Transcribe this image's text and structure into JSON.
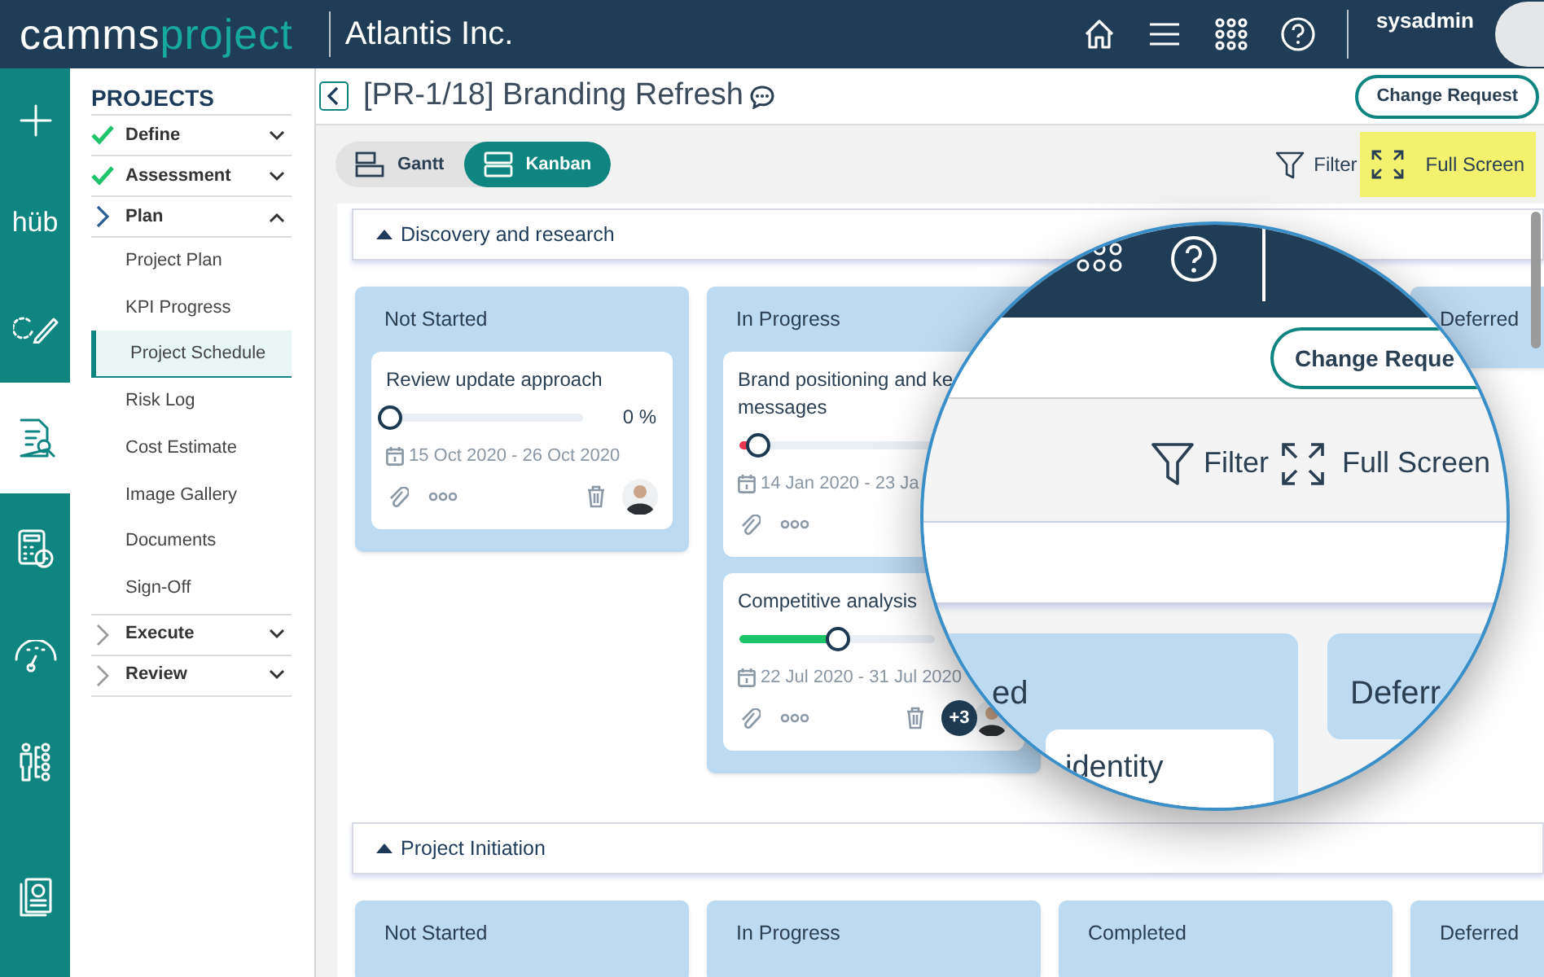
{
  "header": {
    "logo": [
      {
        "text": "camms",
        "kind": "plain"
      },
      {
        "text": "project",
        "kind": "accent"
      }
    ],
    "company": "Atlantis Inc.",
    "user": "sysadmin"
  },
  "rail": [
    {
      "kind": "plus",
      "selected": false
    },
    {
      "kind": "hub",
      "label": "hüb",
      "selected": false
    },
    {
      "kind": "edit",
      "selected": false
    },
    {
      "kind": "document-search",
      "selected": true
    },
    {
      "kind": "calculator",
      "selected": false
    },
    {
      "kind": "gauge",
      "selected": false
    },
    {
      "kind": "people",
      "selected": false
    },
    {
      "kind": "report",
      "selected": false
    }
  ],
  "sidebar": {
    "heading": "PROJECTS",
    "stages": [
      {
        "label": "Define",
        "kind": "done",
        "expanded": false
      },
      {
        "label": "Assessment",
        "kind": "done",
        "expanded": false
      },
      {
        "label": "Plan",
        "kind": "current",
        "expanded": true,
        "items": [
          {
            "label": "Project Plan",
            "selected": false
          },
          {
            "label": "KPI Progress",
            "selected": false
          },
          {
            "label": "Project Schedule",
            "selected": true
          },
          {
            "label": "Risk Log",
            "selected": false
          },
          {
            "label": "Cost Estimate",
            "selected": false
          },
          {
            "label": "Image Gallery",
            "selected": false
          },
          {
            "label": "Documents",
            "selected": false
          },
          {
            "label": "Sign-Off",
            "selected": false
          }
        ]
      },
      {
        "label": "Execute",
        "kind": "pending",
        "expanded": false
      },
      {
        "label": "Review",
        "kind": "pending",
        "expanded": false
      }
    ]
  },
  "page": {
    "title": "[PR-1/18] Branding Refresh",
    "action": "Change Request"
  },
  "views": [
    {
      "label": "Gantt",
      "kind": "gantt",
      "selected": false
    },
    {
      "label": "Kanban",
      "kind": "kanban",
      "selected": true
    }
  ],
  "toolbar": [
    {
      "label": "Filter",
      "kind": "filter",
      "highlighted": false
    },
    {
      "label": "Full Screen",
      "kind": "fullscreen",
      "highlighted": true
    }
  ],
  "sections": [
    {
      "title": "Discovery and research",
      "expanded": true,
      "columns": [
        {
          "kind": "status",
          "title": "Not Started",
          "cards": [
            {
              "title": "Review update approach",
              "level": 0,
              "reading": "0 %",
              "dates": "15 Oct 2020 - 26 Oct 2020",
              "deletable": true,
              "assigned": true
            }
          ]
        },
        {
          "kind": "status",
          "title": "In Progress",
          "cards": [
            {
              "title": "Brand positioning and ke\nmessages",
              "level": 0.08,
              "color": "#e8374f",
              "dates": "14 Jan 2020 - 23 Ja"
            },
            {
              "title": "Competitive analysis",
              "level": 0.49,
              "color": "#1ec46a",
              "dates": "22 Jul 2020 - 31 Jul 2020",
              "more": "+3",
              "deletable": true,
              "assigned": true
            }
          ]
        },
        {
          "kind": "covered"
        },
        {
          "kind": "status",
          "title": "Deferred"
        }
      ]
    },
    {
      "title": "Project Initiation",
      "expanded": true,
      "columns": [
        {
          "kind": "status",
          "title": "Not Started"
        },
        {
          "kind": "status",
          "title": "In Progress"
        },
        {
          "kind": "status",
          "title": "Completed"
        },
        {
          "kind": "status",
          "title": "Deferred"
        }
      ]
    }
  ],
  "magnifier": {
    "button": "Change Reque",
    "tools": [
      {
        "label": "Filter",
        "kind": "filter"
      },
      {
        "label": "Full Screen",
        "kind": "fullscreen"
      }
    ],
    "columns": [
      {
        "title": "ed",
        "card": "identity"
      },
      {
        "title": "Deferr"
      }
    ]
  }
}
